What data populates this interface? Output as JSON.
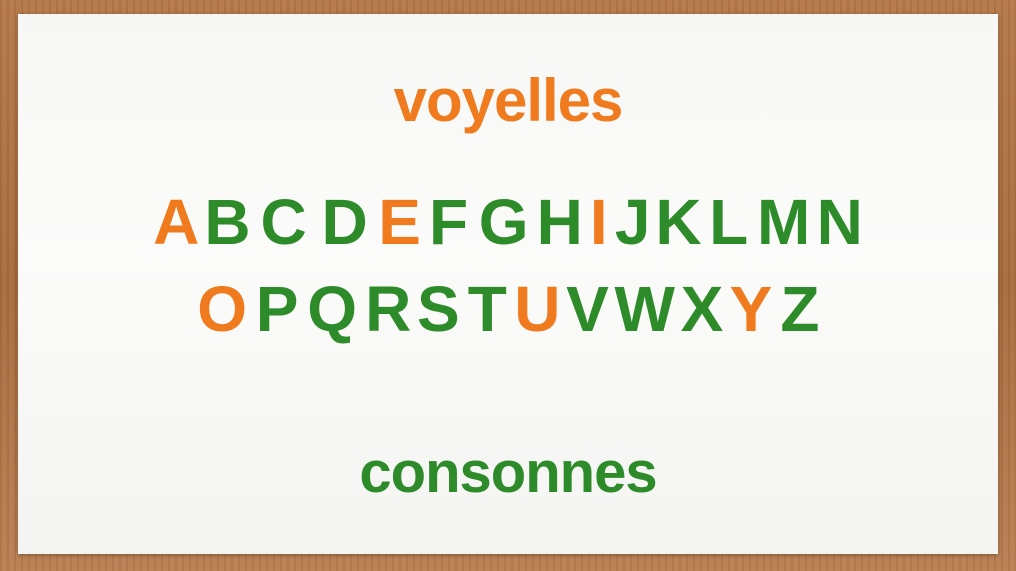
{
  "colors": {
    "vowel": "#f07a1e",
    "consonant": "#2e8b2a"
  },
  "headings": {
    "vowels": "voyelles",
    "consonants": "consonnes"
  },
  "rows": [
    [
      {
        "char": "A",
        "type": "vowel"
      },
      {
        "char": "B",
        "type": "consonant"
      },
      {
        "char": "C",
        "type": "consonant"
      },
      {
        "char": "D",
        "type": "consonant"
      },
      {
        "char": "E",
        "type": "vowel"
      },
      {
        "char": "F",
        "type": "consonant"
      },
      {
        "char": "G",
        "type": "consonant"
      },
      {
        "char": "H",
        "type": "consonant"
      },
      {
        "char": "I",
        "type": "vowel"
      },
      {
        "char": "J",
        "type": "consonant"
      },
      {
        "char": "K",
        "type": "consonant"
      },
      {
        "char": "L",
        "type": "consonant"
      },
      {
        "char": "M",
        "type": "consonant"
      },
      {
        "char": "N",
        "type": "consonant"
      }
    ],
    [
      {
        "char": "O",
        "type": "vowel"
      },
      {
        "char": "P",
        "type": "consonant"
      },
      {
        "char": "Q",
        "type": "consonant"
      },
      {
        "char": "R",
        "type": "consonant"
      },
      {
        "char": "S",
        "type": "consonant"
      },
      {
        "char": "T",
        "type": "consonant"
      },
      {
        "char": "U",
        "type": "vowel"
      },
      {
        "char": "V",
        "type": "consonant"
      },
      {
        "char": "W",
        "type": "consonant"
      },
      {
        "char": "X",
        "type": "consonant"
      },
      {
        "char": "Y",
        "type": "vowel"
      },
      {
        "char": "Z",
        "type": "consonant"
      }
    ]
  ]
}
